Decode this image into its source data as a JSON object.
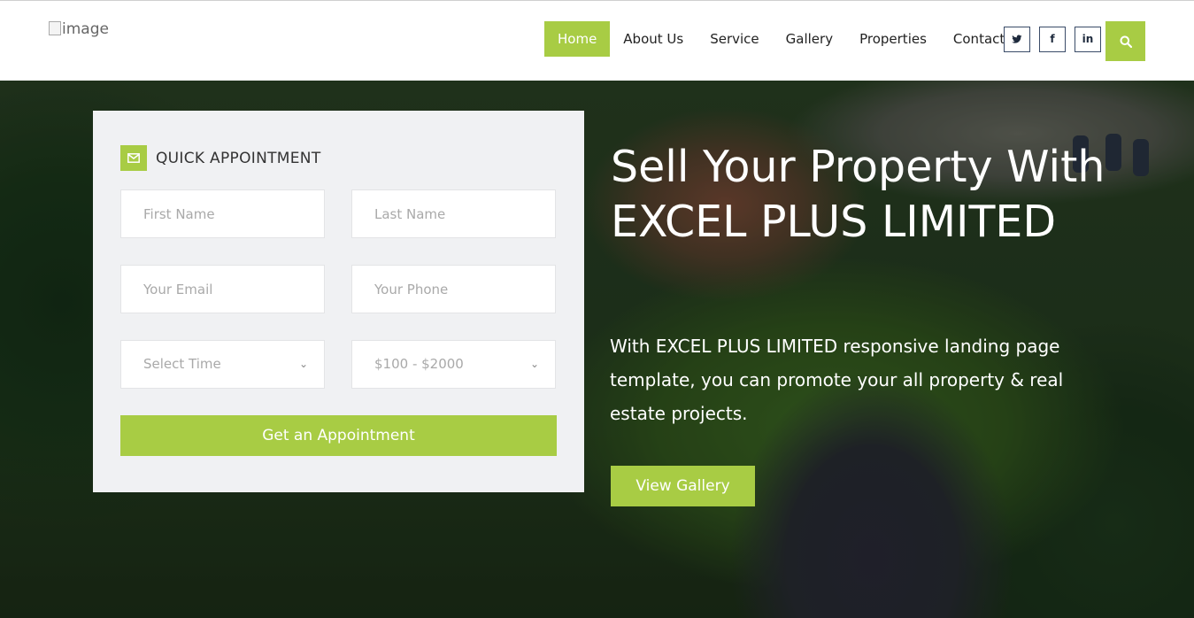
{
  "header": {
    "logo_alt": "image",
    "nav": [
      {
        "label": "Home",
        "active": true
      },
      {
        "label": "About Us"
      },
      {
        "label": "Service"
      },
      {
        "label": "Gallery"
      },
      {
        "label": "Properties"
      },
      {
        "label": "Contact"
      }
    ],
    "social": [
      {
        "icon": "twitter-icon",
        "glyph": "𝕨"
      },
      {
        "icon": "facebook-icon",
        "glyph": "f"
      },
      {
        "icon": "linkedin-icon",
        "glyph": "in"
      }
    ],
    "search_icon": "search-icon"
  },
  "appointment": {
    "title": "QUICK APPOINTMENT",
    "icon": "envelope-icon",
    "first_name_placeholder": "First Name",
    "last_name_placeholder": "Last Name",
    "email_placeholder": "Your Email",
    "phone_placeholder": "Your Phone",
    "time_selected": "Select Time",
    "budget_selected": "$100 - $2000",
    "submit_label": "Get an Appointment"
  },
  "hero": {
    "title": "Sell Your Property With EXCEL PLUS LIMITED",
    "description": "With EXCEL PLUS LIMITED responsive landing page template, you can promote your all property & real estate projects.",
    "cta_label": "View Gallery"
  },
  "colors": {
    "accent": "#a8cc44",
    "card_bg": "#f0f1f3",
    "social_border": "#3a4b68"
  }
}
